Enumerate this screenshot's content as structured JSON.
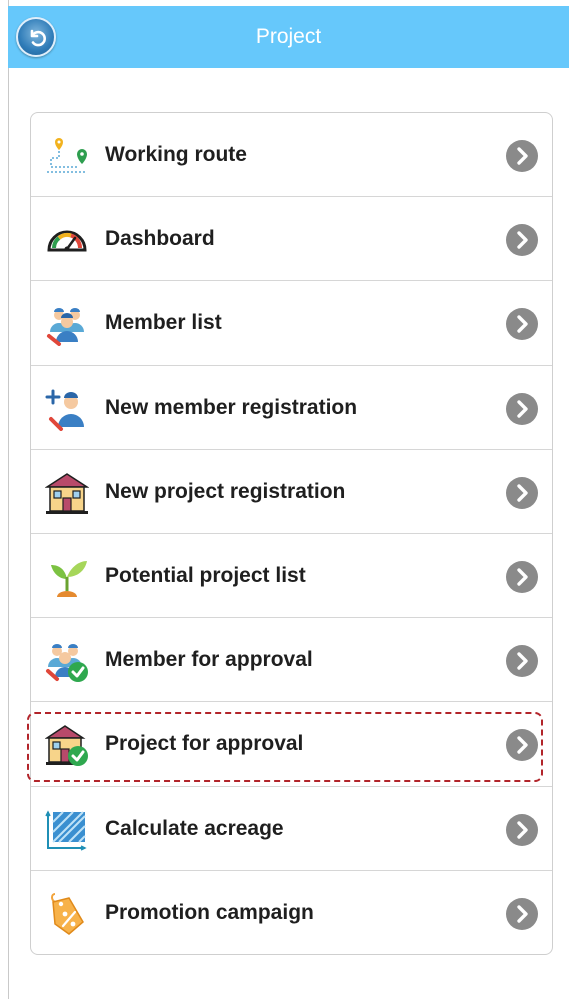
{
  "header": {
    "title": "Project",
    "back_icon": "back-arrow-icon",
    "color": "#66c8fb"
  },
  "menu": {
    "items": [
      {
        "label": "Working route",
        "icon": "map-pin-route-icon"
      },
      {
        "label": "Dashboard",
        "icon": "gauge-icon"
      },
      {
        "label": "Member list",
        "icon": "members-group-icon"
      },
      {
        "label": "New member registration",
        "icon": "add-member-icon"
      },
      {
        "label": "New project registration",
        "icon": "house-icon"
      },
      {
        "label": "Potential project list",
        "icon": "sprout-icon"
      },
      {
        "label": "Member for approval",
        "icon": "members-approved-icon"
      },
      {
        "label": "Project for approval",
        "icon": "house-approved-icon"
      },
      {
        "label": "Calculate acreage",
        "icon": "area-measure-icon"
      },
      {
        "label": "Promotion campaign",
        "icon": "discount-tag-icon"
      }
    ],
    "chevron_icon": "chevron-right-circle-icon",
    "highlighted_item": "Project for approval",
    "highlight_color": "#b2242a"
  }
}
